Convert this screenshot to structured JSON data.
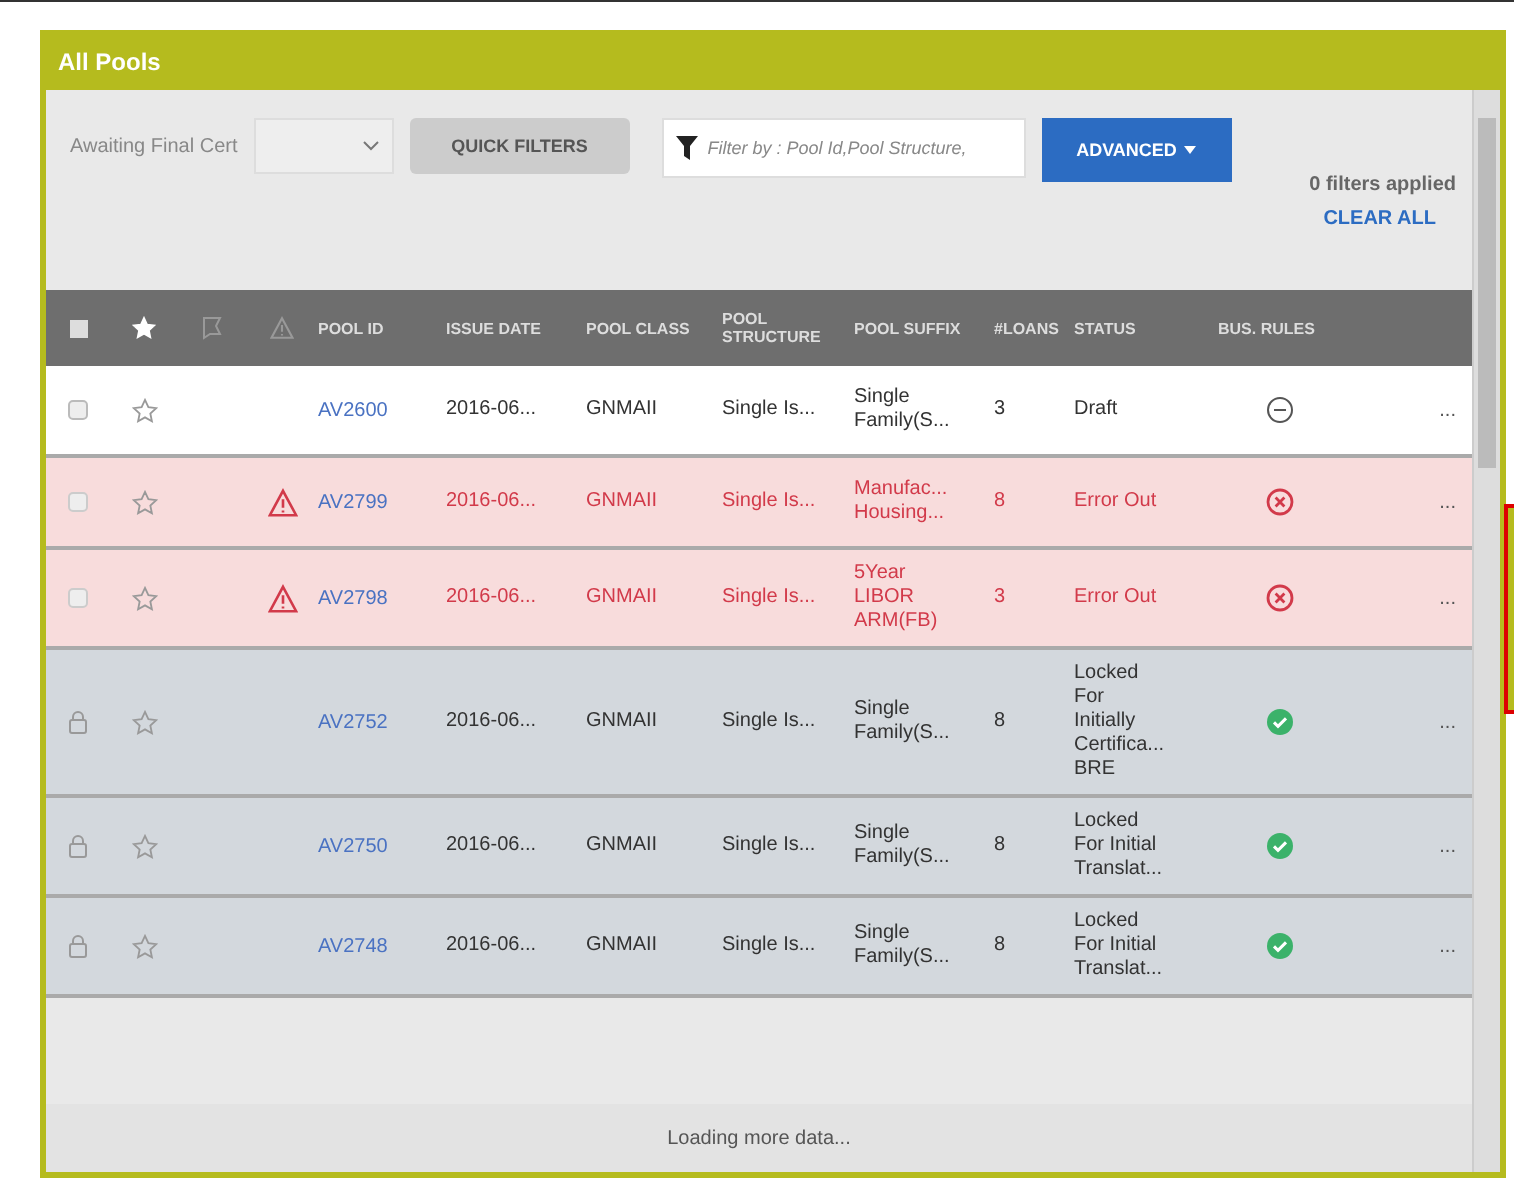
{
  "window": {
    "title": "All Pools"
  },
  "toolbar": {
    "saved_filter": "Awaiting Final Cert",
    "quick_filters": "QUICK FILTERS",
    "search": {
      "placeholder": "Filter by : Pool Id,Pool Structure,"
    },
    "advanced": "ADVANCED",
    "filters_applied": "0 filters applied",
    "clear_all": "CLEAR ALL"
  },
  "table": {
    "select_all": {
      "checked": false
    },
    "columns": [
      "POOL ID",
      "ISSUE DATE",
      "POOL CLASS",
      "POOL STRUCTURE",
      "POOL SUFFIX",
      "#LOANS",
      "STATUS",
      "BUS. RULES"
    ],
    "rows": [
      {
        "kind": "normal",
        "warning": false,
        "pool_id": "AV2600",
        "issue_date": "2016-06...",
        "pool_class": "GNMAII",
        "structure": "Single Is...",
        "suffix": [
          "Single",
          "Family(S..."
        ],
        "loans": "3",
        "status": [
          "Draft"
        ],
        "bus_rule": {
          "kind": "none"
        },
        "more": "..."
      },
      {
        "kind": "error",
        "warning": true,
        "pool_id": "AV2799",
        "issue_date": "2016-06...",
        "pool_class": "GNMAII",
        "structure": "Single Is...",
        "suffix": [
          "Manufac...",
          "Housing..."
        ],
        "loans": "8",
        "status": [
          "Error Out"
        ],
        "bus_rule": {
          "kind": "fail"
        },
        "more": "..."
      },
      {
        "kind": "error",
        "warning": true,
        "pool_id": "AV2798",
        "issue_date": "2016-06...",
        "pool_class": "GNMAII",
        "structure": "Single Is...",
        "suffix": [
          "5Year",
          "LIBOR",
          "ARM(FB)"
        ],
        "loans": "3",
        "status": [
          "Error Out"
        ],
        "bus_rule": {
          "kind": "fail"
        },
        "more": "..."
      },
      {
        "kind": "locked",
        "warning": false,
        "pool_id": "AV2752",
        "issue_date": "2016-06...",
        "pool_class": "GNMAII",
        "structure": "Single Is...",
        "suffix": [
          "Single",
          "Family(S..."
        ],
        "loans": "8",
        "status": [
          "Locked",
          "For",
          "Initially",
          "Certifica...",
          "BRE"
        ],
        "bus_rule": {
          "kind": "pass"
        },
        "more": "..."
      },
      {
        "kind": "locked",
        "warning": false,
        "pool_id": "AV2750",
        "issue_date": "2016-06...",
        "pool_class": "GNMAII",
        "structure": "Single Is...",
        "suffix": [
          "Single",
          "Family(S..."
        ],
        "loans": "8",
        "status": [
          "Locked",
          "For Initial",
          "Translat..."
        ],
        "bus_rule": {
          "kind": "pass"
        },
        "more": "..."
      },
      {
        "kind": "locked",
        "warning": false,
        "pool_id": "AV2748",
        "issue_date": "2016-06...",
        "pool_class": "GNMAII",
        "structure": "Single Is...",
        "suffix": [
          "Single",
          "Family(S..."
        ],
        "loans": "8",
        "status": [
          "Locked",
          "For Initial",
          "Translat..."
        ],
        "bus_rule": {
          "kind": "pass"
        },
        "more": "..."
      }
    ]
  },
  "footer": "Loading more data..."
}
